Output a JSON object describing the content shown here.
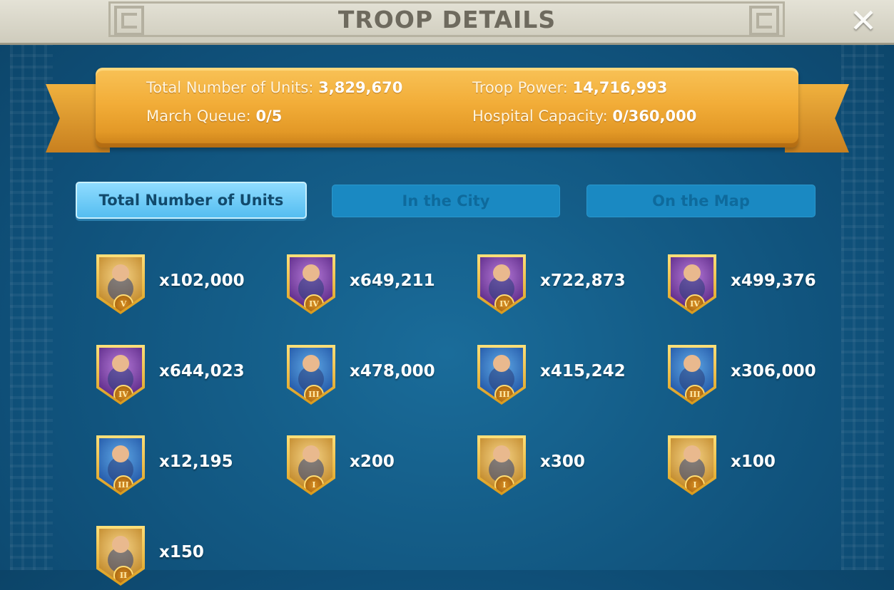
{
  "header": {
    "title": "TROOP DETAILS",
    "close_icon": "close-icon"
  },
  "summary": {
    "total_units_label": "Total Number of Units:",
    "total_units_value": "3,829,670",
    "troop_power_label": "Troop Power:",
    "troop_power_value": "14,716,993",
    "march_queue_label": "March Queue:",
    "march_queue_value": "0/5",
    "hospital_label": "Hospital Capacity:",
    "hospital_value": "0/360,000"
  },
  "tabs": [
    {
      "label": "Total Number of Units",
      "active": true
    },
    {
      "label": "In the City",
      "active": false
    },
    {
      "label": "On the Map",
      "active": false
    }
  ],
  "units": [
    {
      "count": "x102,000",
      "tier": "V",
      "portrait": "gold",
      "icon": "general-unit-icon"
    },
    {
      "count": "x649,211",
      "tier": "IV",
      "portrait": "purple",
      "icon": "infantry-unit-icon"
    },
    {
      "count": "x722,873",
      "tier": "IV",
      "portrait": "purple",
      "icon": "cavalry-unit-icon"
    },
    {
      "count": "x499,376",
      "tier": "IV",
      "portrait": "purple",
      "icon": "archer-unit-icon"
    },
    {
      "count": "x644,023",
      "tier": "IV",
      "portrait": "purple",
      "icon": "siege-unit-icon"
    },
    {
      "count": "x478,000",
      "tier": "III",
      "portrait": "blue",
      "icon": "infantry-unit-icon"
    },
    {
      "count": "x415,242",
      "tier": "III",
      "portrait": "blue",
      "icon": "cavalry-unit-icon"
    },
    {
      "count": "x306,000",
      "tier": "III",
      "portrait": "blue",
      "icon": "archer-unit-icon"
    },
    {
      "count": "x12,195",
      "tier": "III",
      "portrait": "blue",
      "icon": "siege-unit-icon"
    },
    {
      "count": "x200",
      "tier": "I",
      "portrait": "gold",
      "icon": "infantry-unit-icon"
    },
    {
      "count": "x300",
      "tier": "I",
      "portrait": "gold",
      "icon": "cavalry-unit-icon"
    },
    {
      "count": "x100",
      "tier": "I",
      "portrait": "gold",
      "icon": "archer-unit-icon"
    },
    {
      "count": "x150",
      "tier": "II",
      "portrait": "gold",
      "icon": "siege-unit-icon"
    }
  ]
}
